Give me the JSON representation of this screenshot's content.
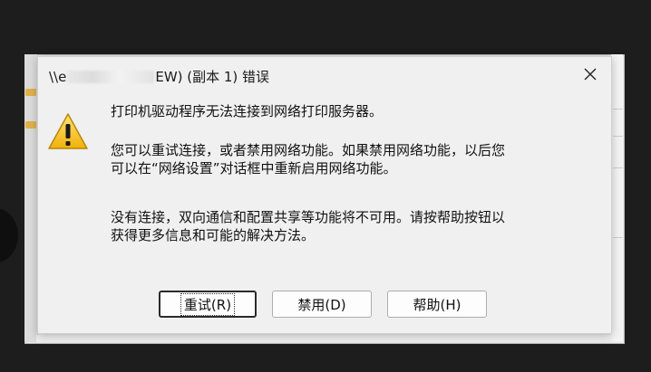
{
  "dialog": {
    "title_prefix": "\\\\e",
    "title_suffix": "EW) (副本 1) 错误",
    "icons": {
      "close": "close-icon",
      "warning": "warning-triangle-icon"
    },
    "messages": [
      "打印机驱动程序无法连接到网络打印服务器。",
      "您可以重试连接，或者禁用网络功能。如果禁用网络功能，以后您\n可以在“网络设置”对话框中重新启用网络功能。",
      "没有连接，双向通信和配置共享等功能将不可用。请按帮助按钮以\n获得更多信息和可能的解决方法。"
    ],
    "buttons": {
      "retry": "重试(R)",
      "disable": "禁用(D)",
      "help": "帮助(H)"
    }
  },
  "colors": {
    "screen_background": "#1d1d1d",
    "dialog_background": "#f0f0f0",
    "warning_yellow": "#f6c21c"
  }
}
